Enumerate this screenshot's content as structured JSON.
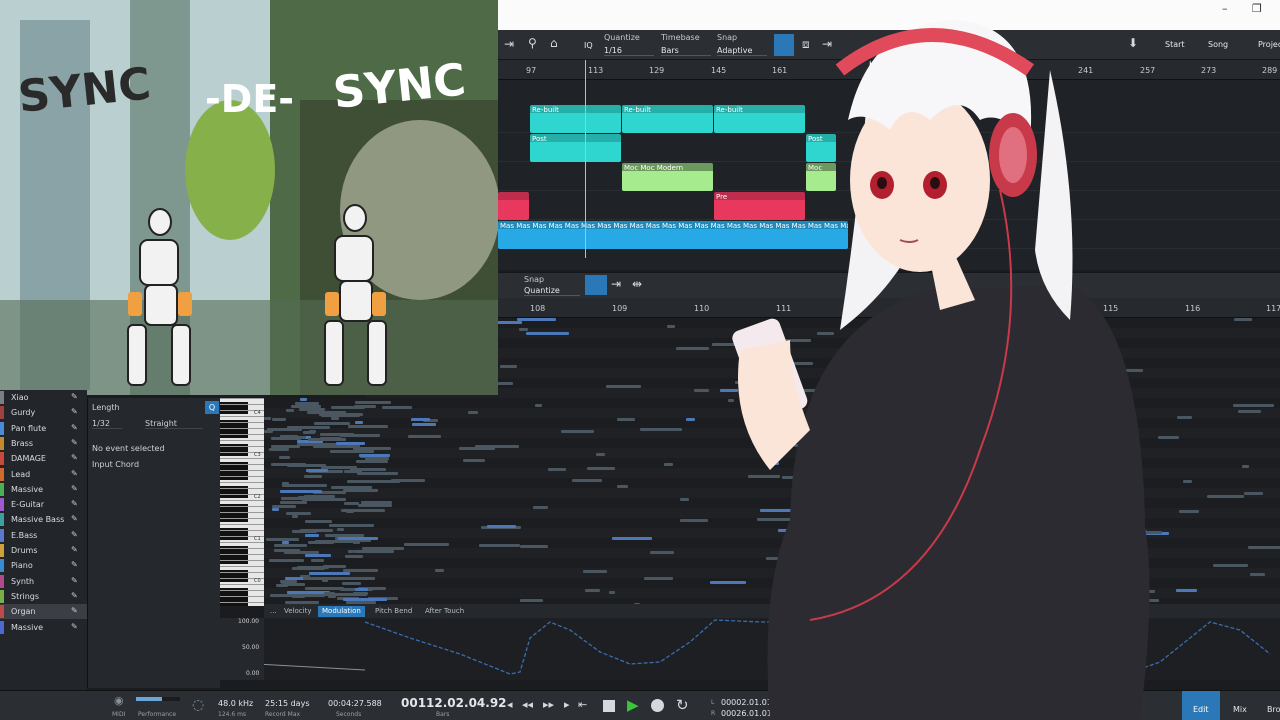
{
  "window": {
    "minimize": "–",
    "maximize": "❐"
  },
  "toolbar": {
    "quantize_label": "Quantize",
    "quantize_value": "1/16",
    "timebase_label": "Timebase",
    "timebase_value": "Bars",
    "snap_label": "Snap",
    "snap_value": "Adaptive",
    "iq_label": "IQ",
    "start_label": "Start",
    "song_label": "Song",
    "project_label": "Projec"
  },
  "arrange_ruler": [
    "97",
    "113",
    "129",
    "145",
    "161",
    "241",
    "257",
    "273",
    "289"
  ],
  "clips": [
    {
      "label": "Re-built",
      "lane": 0,
      "color": "#2fd6cf"
    },
    {
      "label": "Re-built",
      "lane": 0,
      "color": "#2fd6cf"
    },
    {
      "label": "Re-built",
      "lane": 0,
      "color": "#2fd6cf"
    },
    {
      "label": "Post",
      "lane": 1,
      "color": "#2fd6cf"
    },
    {
      "label": "Post",
      "lane": 1,
      "color": "#2fd6cf"
    },
    {
      "label": "Moc Moc Modern",
      "lane": 2,
      "color": "#a6ec8f"
    },
    {
      "label": "Moc",
      "lane": 2,
      "color": "#a6ec8f"
    },
    {
      "label": "Pre",
      "lane": 3,
      "color": "#e8385e"
    },
    {
      "label": "",
      "lane": 3,
      "color": "#e8385e"
    },
    {
      "label": "Mas Mas Mas Mas Mas Mas Mas Mas Mas Mas Mas Mas Mas Mas Mas Mas Mas Mas Mas Mas Mas Mas Mas Mas Mas Mas Mas Mas Mas Mas",
      "lane": 4,
      "color": "#27a9e6"
    }
  ],
  "editor_toolbar": {
    "snap_label": "Snap",
    "snap_value": "Quantize"
  },
  "editor_ruler": [
    "108",
    "109",
    "110",
    "111",
    "115",
    "116",
    "117"
  ],
  "inspector": {
    "length_label": "Length",
    "quant_value": "1/32",
    "straight_value": "Straight",
    "no_event": "No event selected",
    "input_chord": "Input Chord",
    "q_button": "Q"
  },
  "tracks": [
    {
      "name": "Xiao",
      "color": "#7a7f86"
    },
    {
      "name": "Gurdy",
      "color": "#a04040"
    },
    {
      "name": "Pan flute",
      "color": "#4a8ad6"
    },
    {
      "name": "Brass",
      "color": "#c48a2a"
    },
    {
      "name": "DAMAGE",
      "color": "#c84a3a"
    },
    {
      "name": "Lead",
      "color": "#d06a2a"
    },
    {
      "name": "Massive",
      "color": "#4ab050"
    },
    {
      "name": "E-Guitar",
      "color": "#a05ad0"
    },
    {
      "name": "Massive Bass",
      "color": "#3aa0a0"
    },
    {
      "name": "E.Bass",
      "color": "#5a7ad0"
    },
    {
      "name": "Drums",
      "color": "#d0a03a"
    },
    {
      "name": "Piano",
      "color": "#3a8ad0"
    },
    {
      "name": "Synth",
      "color": "#b04a8a"
    },
    {
      "name": "Strings",
      "color": "#7ab04a"
    },
    {
      "name": "Organ",
      "color": "#c04a4a"
    },
    {
      "name": "Massive",
      "color": "#4a6ad0"
    }
  ],
  "piano_octaves": [
    "C4",
    "C3",
    "C2",
    "C1",
    "C0"
  ],
  "automation": {
    "tabs": [
      "...",
      "Velocity",
      "Modulation",
      "Pitch Bend",
      "After Touch"
    ],
    "active_tab": "Modulation",
    "scale": [
      "100.00",
      "50.00",
      "0.00"
    ]
  },
  "transport": {
    "midi": "MIDI",
    "performance": "Performance",
    "sample_rate": "48.0 kHz",
    "latency": "124.6 ms",
    "record_days": "25:15 days",
    "record_max": "Record Max",
    "seconds_value": "00:04:27.588",
    "seconds_label": "Seconds",
    "bars_value": "00112.02.04.92",
    "bars_label": "Bars",
    "loop_l": "00002.01.01.00",
    "loop_r": "00026.01.01.00",
    "l_label": "L",
    "r_label": "R",
    "edit_tab": "Edit",
    "mix_tab": "Mix",
    "browse_tab": "Bro"
  },
  "video_overlay": {
    "title_part1": "SYNC",
    "title_part2": "-DE-",
    "title_part3": "SYNC"
  }
}
